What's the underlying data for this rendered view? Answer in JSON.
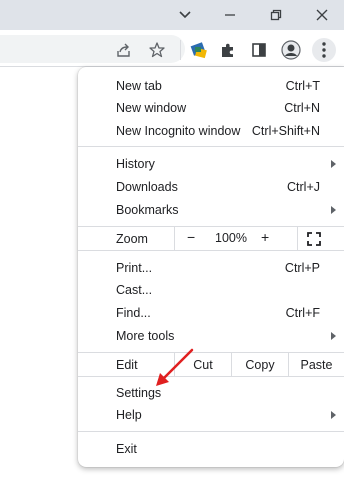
{
  "window_controls": {
    "tab_list_icon": "chevron-down-icon",
    "minimize_icon": "minimize-icon",
    "restore_icon": "restore-icon",
    "close_icon": "close-icon"
  },
  "toolbar": {
    "icons": [
      "share-icon",
      "bookmark-star-icon",
      "extension-app-icon",
      "puzzle-extensions-icon",
      "side-panel-icon",
      "profile-icon",
      "more-menu-icon"
    ]
  },
  "menu": {
    "new_tab": {
      "label": "New tab",
      "shortcut": "Ctrl+T"
    },
    "new_window": {
      "label": "New window",
      "shortcut": "Ctrl+N"
    },
    "new_incognito": {
      "label": "New Incognito window",
      "shortcut": "Ctrl+Shift+N"
    },
    "history": {
      "label": "History"
    },
    "downloads": {
      "label": "Downloads",
      "shortcut": "Ctrl+J"
    },
    "bookmarks": {
      "label": "Bookmarks"
    },
    "zoom": {
      "label": "Zoom",
      "minus": "−",
      "value": "100%",
      "plus": "+",
      "fullscreen_icon": "fullscreen-icon"
    },
    "print": {
      "label": "Print...",
      "shortcut": "Ctrl+P"
    },
    "cast": {
      "label": "Cast..."
    },
    "find": {
      "label": "Find...",
      "shortcut": "Ctrl+F"
    },
    "more_tools": {
      "label": "More tools"
    },
    "edit": {
      "label": "Edit",
      "cut": "Cut",
      "copy": "Copy",
      "paste": "Paste"
    },
    "settings": {
      "label": "Settings"
    },
    "help": {
      "label": "Help"
    },
    "exit": {
      "label": "Exit"
    }
  },
  "annotation": {
    "color": "#e02020",
    "icon": "red-arrow-pointer"
  }
}
